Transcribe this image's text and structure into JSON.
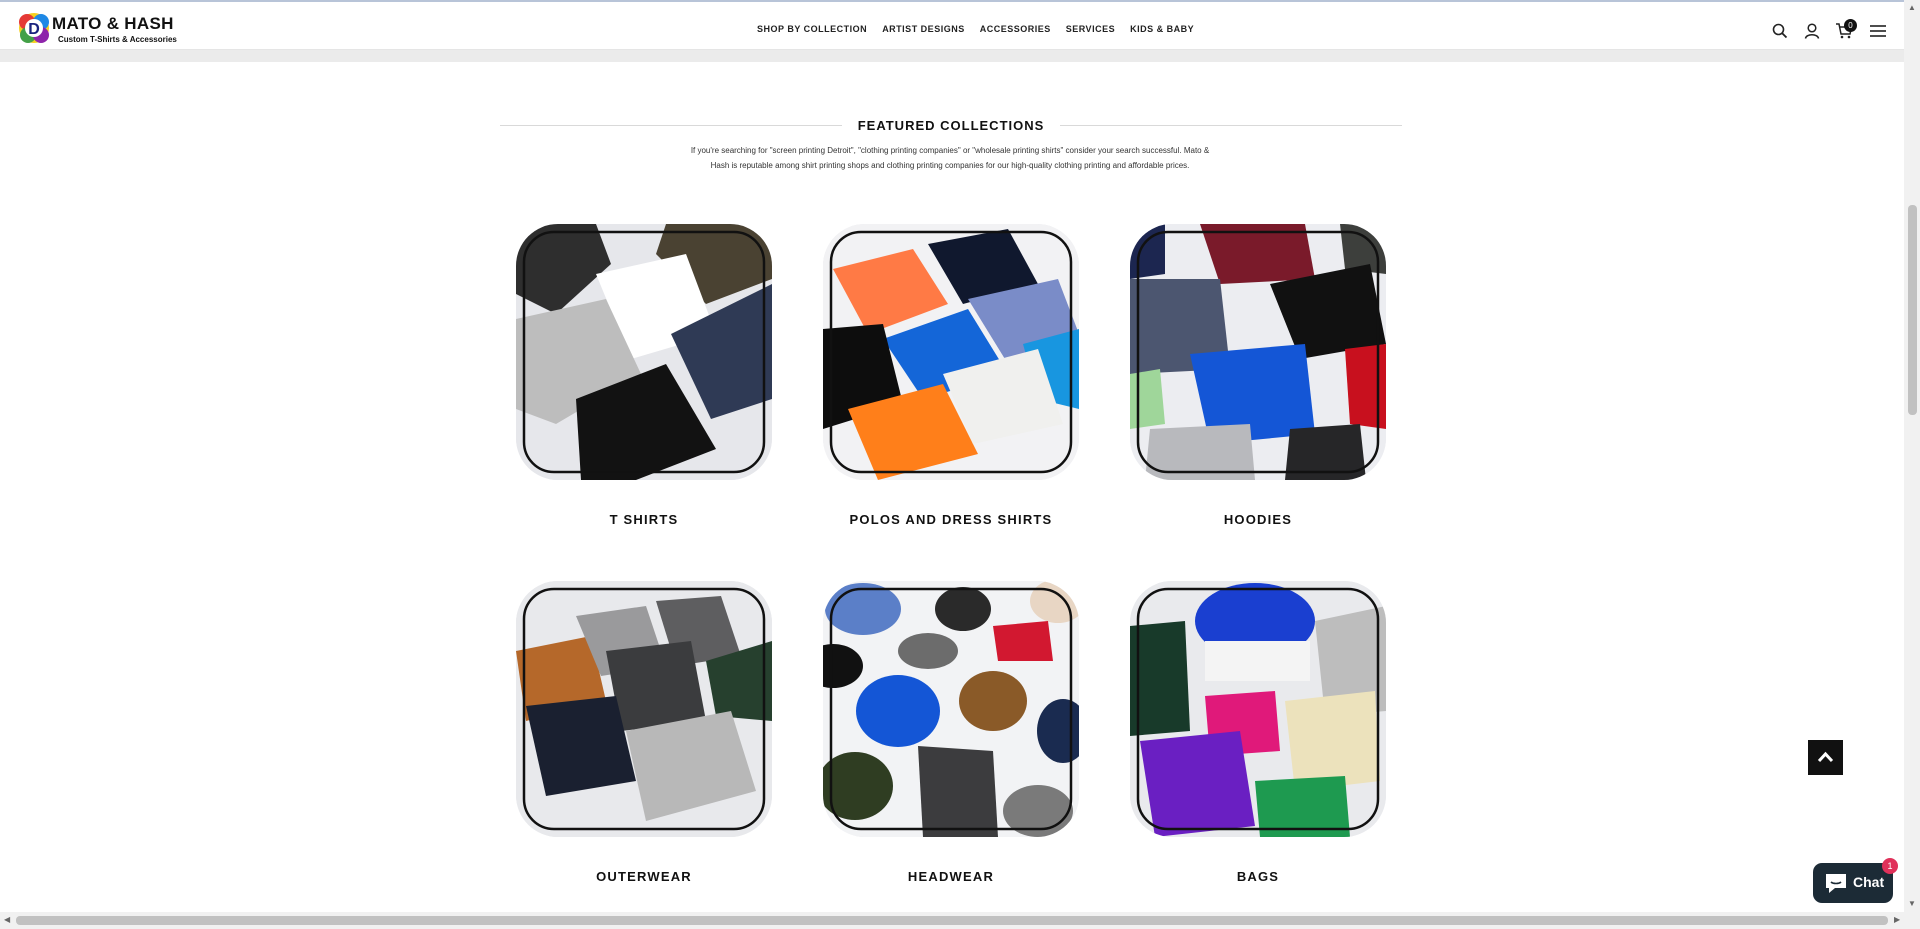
{
  "header": {
    "logo_title": "MATO & HASH",
    "logo_subtitle": "Custom T-Shirts & Accessories",
    "nav": [
      {
        "label": "SHOP BY COLLECTION"
      },
      {
        "label": "ARTIST DESIGNS"
      },
      {
        "label": "ACCESSORIES"
      },
      {
        "label": "SERVICES"
      },
      {
        "label": "KIDS & BABY"
      }
    ],
    "icons": [
      "search-icon",
      "user-icon",
      "cart-icon",
      "menu-icon"
    ],
    "cart_count": "0"
  },
  "featured": {
    "title": "FEATURED COLLECTIONS",
    "description": "If you're searching for \"screen printing Detroit\", \"clothing printing companies\" or \"wholesale printing shirts\" consider your search successful. Mato & Hash is reputable among shirt printing shops and clothing printing companies for our high-quality clothing printing and affordable prices.",
    "collections": [
      {
        "label": "T SHIRTS"
      },
      {
        "label": "POLOS AND DRESS SHIRTS"
      },
      {
        "label": "HOODIES"
      },
      {
        "label": "OUTERWEAR"
      },
      {
        "label": "HEADWEAR"
      },
      {
        "label": "BAGS"
      }
    ]
  },
  "widgets": {
    "chat_label": "Chat",
    "chat_badge": "1",
    "back_to_top_icon": "chevron-up-icon"
  },
  "colors": {
    "accent": "#111111",
    "chat_bg": "#1c2b36",
    "chat_badge": "#e0315a"
  }
}
